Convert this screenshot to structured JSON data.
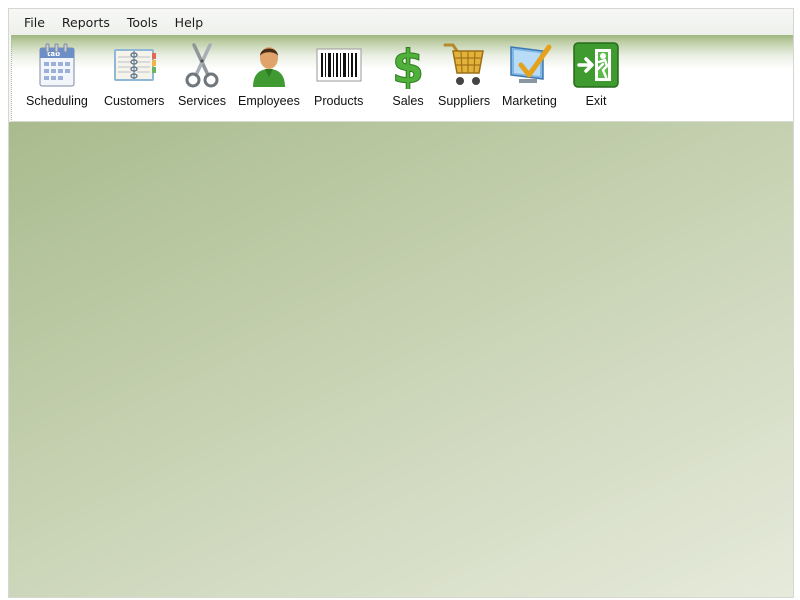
{
  "menu": [
    "File",
    "Reports",
    "Tools",
    "Help"
  ],
  "toolbar": {
    "buttons": [
      {
        "label": "Scheduling",
        "icon": "calendar-icon"
      },
      {
        "label": "Customers",
        "icon": "address-book-icon"
      },
      {
        "label": "Services",
        "icon": "scissors-icon"
      },
      {
        "label": "Employees",
        "icon": "person-icon"
      },
      {
        "label": "Products",
        "icon": "barcode-icon"
      },
      {
        "label": "Sales",
        "icon": "dollar-icon"
      },
      {
        "label": "Suppliers",
        "icon": "cart-icon"
      },
      {
        "label": "Marketing",
        "icon": "monitor-check-icon"
      },
      {
        "label": "Exit",
        "icon": "exit-icon"
      }
    ]
  },
  "colors": {
    "toolbar_top": "#9fb67f",
    "workspace_start": "#a9bb8e",
    "workspace_end": "#e6eadb",
    "sales_green": "#4fb03a",
    "exit_green": "#3f9a2f"
  }
}
